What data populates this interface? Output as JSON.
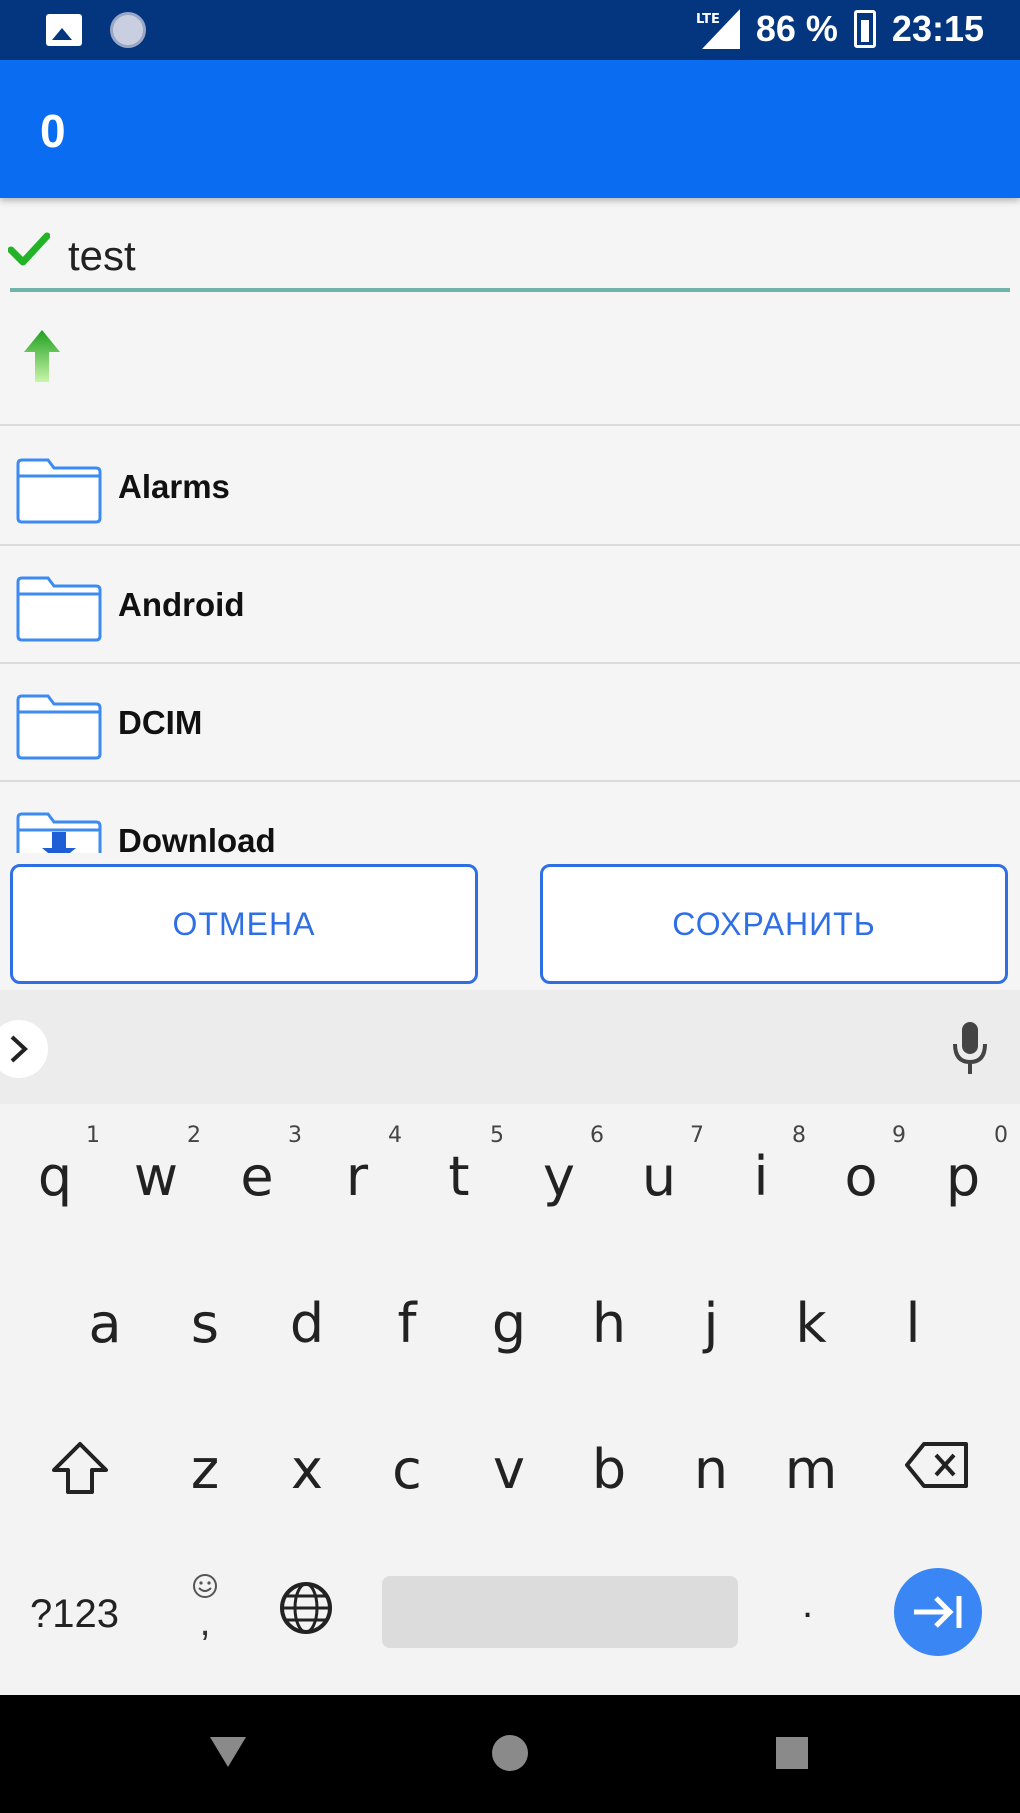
{
  "status_bar": {
    "network": "LTE",
    "battery": "86 %",
    "time": "23:15"
  },
  "app_bar": {
    "title": "0"
  },
  "file_name": {
    "value": "test"
  },
  "folders": [
    {
      "label": "Alarms",
      "icon": "folder-icon"
    },
    {
      "label": "Android",
      "icon": "folder-icon"
    },
    {
      "label": "DCIM",
      "icon": "folder-icon"
    },
    {
      "label": "Download",
      "icon": "download-folder-icon"
    }
  ],
  "buttons": {
    "cancel": "ОТМЕНА",
    "save": "СОХРАНИТЬ"
  },
  "keyboard": {
    "row1": [
      {
        "key": "q",
        "hint": "1"
      },
      {
        "key": "w",
        "hint": "2"
      },
      {
        "key": "e",
        "hint": "3"
      },
      {
        "key": "r",
        "hint": "4"
      },
      {
        "key": "t",
        "hint": "5"
      },
      {
        "key": "y",
        "hint": "6"
      },
      {
        "key": "u",
        "hint": "7"
      },
      {
        "key": "i",
        "hint": "8"
      },
      {
        "key": "o",
        "hint": "9"
      },
      {
        "key": "p",
        "hint": "0"
      }
    ],
    "row2": [
      "a",
      "s",
      "d",
      "f",
      "g",
      "h",
      "j",
      "k",
      "l"
    ],
    "row3": [
      "z",
      "x",
      "c",
      "v",
      "b",
      "n",
      "m"
    ],
    "symbols": "?123",
    "comma": ",",
    "period": "."
  },
  "colors": {
    "status_bar": "#04357f",
    "app_bar": "#0a6cf0",
    "accent": "#2f6fe6",
    "enter": "#3a86f4"
  }
}
